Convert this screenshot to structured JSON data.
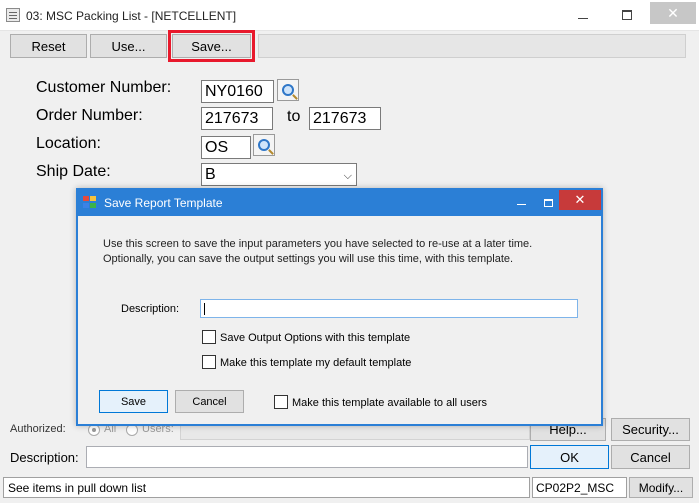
{
  "window": {
    "title": "03: MSC Packing List - [NETCELLENT]",
    "close_glyph": "✕"
  },
  "toolbar": {
    "reset_label": "Reset",
    "use_label": "Use...",
    "save_label": "Save..."
  },
  "form": {
    "customer_number_label": "Customer Number:",
    "customer_number_value": "NY0160",
    "order_number_label": "Order Number:",
    "order_from_value": "217673",
    "to_label": "to",
    "order_to_value": "217673",
    "location_label": "Location:",
    "location_value": "OS",
    "ship_date_label": "Ship Date:",
    "ship_date_value": "B"
  },
  "bottom": {
    "authorized_label": "Authorized:",
    "radio_all_label": "All",
    "radio_users_label": "Users:",
    "help_label": "Help...",
    "security_label": "Security...",
    "description_label": "Description:",
    "description_value": "",
    "ok_label": "OK",
    "cancel_label": "Cancel"
  },
  "status_bar": {
    "message": "See items in pull down list",
    "code": "CP02P2_MSC",
    "modify_label": "Modify..."
  },
  "dialog": {
    "title": "Save Report Template",
    "intro_line1": "Use this screen to save the input parameters you have selected to re-use at a later time.",
    "intro_line2": "Optionally, you can save the output settings you will use this time, with this template.",
    "description_label": "Description:",
    "description_value": "",
    "save_output_label": "Save Output Options with this template",
    "make_default_label": "Make this template my default template",
    "available_all_label": "Make this template available to all users",
    "save_label": "Save",
    "cancel_label": "Cancel",
    "close_glyph": "✕"
  },
  "colors": {
    "dialog_accent": "#2b7fd6",
    "highlight": "#e8192c",
    "close_red": "#c73a3a"
  }
}
